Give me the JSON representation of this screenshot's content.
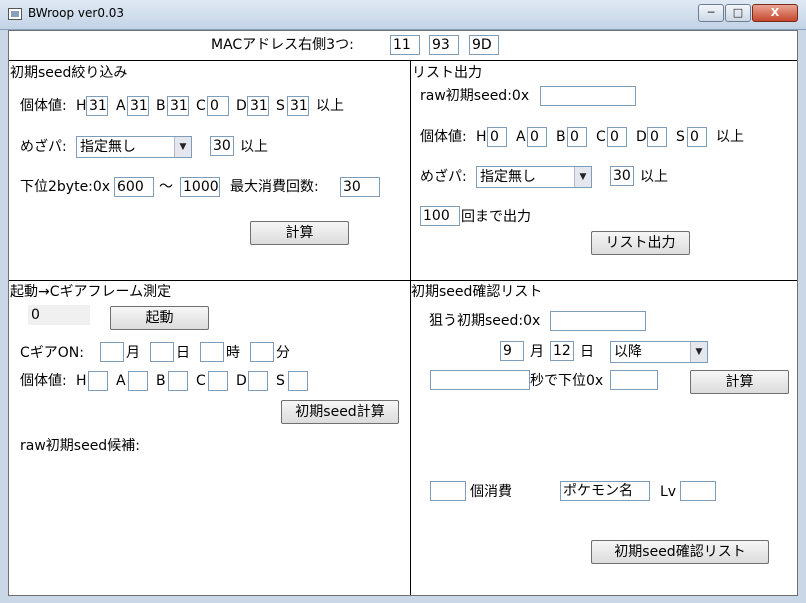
{
  "window": {
    "title": "BWroop ver0.03",
    "minimize": "─",
    "maximize": "□",
    "close": "X"
  },
  "mac": {
    "label": "MACアドレス右側3つ:",
    "v1": "11",
    "v2": "93",
    "v3": "9D"
  },
  "narrow": {
    "title": "初期seed絞り込み",
    "iv_label": "個体値:",
    "H": "H",
    "A": "A",
    "B": "B",
    "C": "C",
    "D": "D",
    "S": "S",
    "hv": "31",
    "av": "31",
    "bv": "31",
    "cv": "0",
    "dv": "31",
    "sv": "31",
    "above": "以上",
    "mezapa_label": "めざパ:",
    "mezapa_value": "指定無し",
    "mezapa_power": "30",
    "mezapa_above": "以上",
    "lower_label": "下位2byte:0x",
    "lower_from": "600",
    "tilde": "〜",
    "lower_to": "1000",
    "max_label": "最大消費回数:",
    "max_value": "30",
    "calc_button": "計算"
  },
  "list": {
    "title": "リスト出力",
    "raw_label": "raw初期seed:0x",
    "raw_value": "",
    "iv_label": "個体値:",
    "H": "H",
    "A": "A",
    "B": "B",
    "C": "C",
    "D": "D",
    "S": "S",
    "hv": "0",
    "av": "0",
    "bv": "0",
    "cv": "0",
    "dv": "0",
    "sv": "0",
    "above": "以上",
    "mezapa_label": "めざパ:",
    "mezapa_value": "指定無し",
    "mezapa_power": "30",
    "mezapa_above": "以上",
    "count_value": "100",
    "count_label": "回まで出力",
    "output_button": "リスト出力"
  },
  "frame": {
    "title": "起動→Cギアフレーム測定",
    "counter": "0",
    "start_button": "起動",
    "cgear_label": "CギアON:",
    "month": "月",
    "day": "日",
    "hour": "時",
    "minute": "分",
    "iv_label": "個体値:",
    "H": "H",
    "A": "A",
    "B": "B",
    "C": "C",
    "D": "D",
    "S": "S",
    "calc_button": "初期seed計算",
    "candidates_label": "raw初期seed候補:"
  },
  "confirm": {
    "title": "初期seed確認リスト",
    "target_label": "狙う初期seed:0x",
    "target_value": "",
    "month_value": "9",
    "month_label": "月",
    "day_value": "12",
    "day_label": "日",
    "after_value": "以降",
    "seconds_value": "",
    "seconds_label": "秒で下位0x",
    "lower_value": "",
    "calc_button": "計算",
    "consume_value": "",
    "consume_label": "個消費",
    "pokemon_value": "ポケモン名",
    "lv_label": "Lv",
    "lv_value": "",
    "list_button": "初期seed確認リスト"
  }
}
